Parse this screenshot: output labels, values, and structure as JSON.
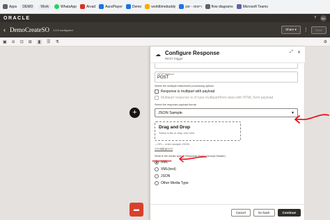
{
  "bookmarks": [
    {
      "label": "Apps",
      "color": "#5f6368"
    },
    {
      "label": "DEMO",
      "color": "#5f6368",
      "chip": true
    },
    {
      "label": "Work",
      "color": "#5f6368",
      "chip": true
    },
    {
      "label": "WhatsApp",
      "color": "#25d366"
    },
    {
      "label": "Arvad",
      "color": "#d93025"
    },
    {
      "label": "AuraPlayer",
      "color": "#1a73e8"
    },
    {
      "label": "Demo",
      "color": "#1a73e8"
    },
    {
      "label": "worldtimebuddy",
      "color": "#f9ab00"
    },
    {
      "label": "ריסוס - יומן",
      "color": "#1a73e8"
    },
    {
      "label": "flow diagrams",
      "color": "#5f6368"
    },
    {
      "label": "Microsoft Teams",
      "color": "#6264a7"
    }
  ],
  "brand": {
    "logo": "ORACLE",
    "user_initials": "AU",
    "help": "?"
  },
  "header": {
    "title": "DemoCreateSO",
    "badge": "1.0.0 configured",
    "share_label": "Share",
    "save_label": "Save"
  },
  "panel": {
    "title": "Configure Response",
    "subtitle": "REST trigger",
    "top_cut_value": "",
    "method_label": "HTTP Method",
    "method_value": "POST",
    "multipart_help": "Select the multipart attachment processing options",
    "multipart_check": "Response is multipart with payload",
    "multipart_form": "Multipart response is of type multipart/form-data with HTML form payload",
    "payload_help": "Select the response payload format",
    "payload_select": "JSON Sample",
    "dropzone_title": "Drag and Drop",
    "dropzone_sub": "Select a file or drop one here",
    "or_text": "—OR— enter sample JSON",
    "paste_link": "<<<inline>>>",
    "media_help": "What is the media-type of Response Body? (Accept Header)",
    "media_options": [
      {
        "label": "XML",
        "selected": true
      },
      {
        "label": "XML(text)",
        "selected": false
      },
      {
        "label": "JSON",
        "selected": false
      },
      {
        "label": "Other Media Type",
        "selected": false
      }
    ],
    "cancel_label": "Cancel",
    "back_label": "Go back",
    "continue_label": "Continue"
  },
  "colors": {
    "annotation": "#e8131a",
    "brand_dark": "#312d2a",
    "chat": "#d9402b"
  }
}
